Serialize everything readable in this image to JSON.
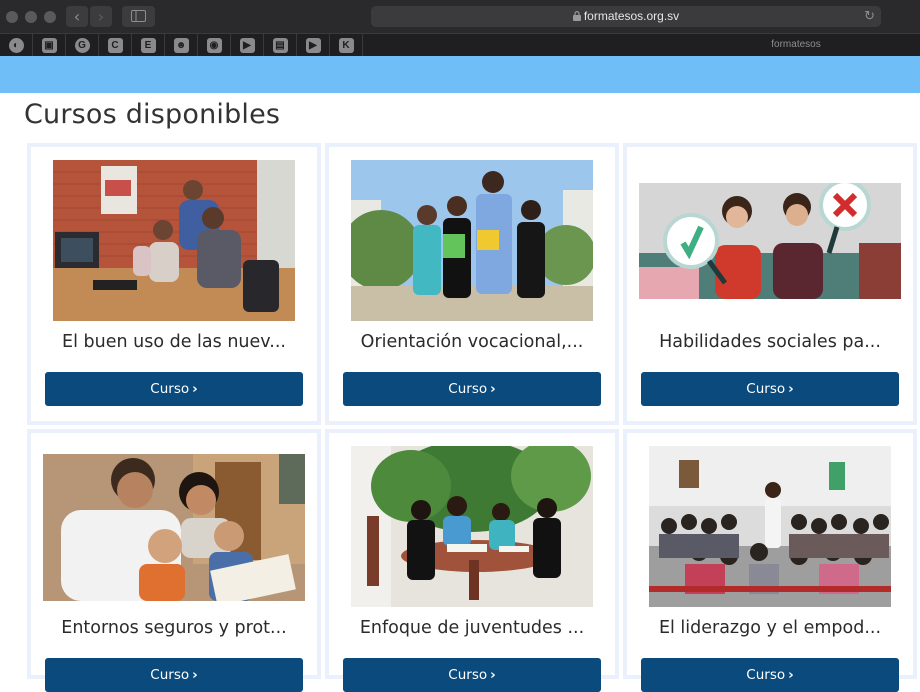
{
  "browser": {
    "url": "formatesos.org.sv",
    "tab_title": "formatesos",
    "back_glyph": "‹",
    "forward_glyph": "›",
    "reload_glyph": "↻",
    "lock_glyph": "🔒"
  },
  "bookmarks": [
    {
      "icon": "globe-icon",
      "glyph": "◐"
    },
    {
      "icon": "news-icon",
      "glyph": "▣"
    },
    {
      "icon": "g-icon",
      "glyph": "G"
    },
    {
      "icon": "c-icon",
      "glyph": "C"
    },
    {
      "icon": "e-icon",
      "glyph": "E"
    },
    {
      "icon": "face-icon",
      "glyph": "☻"
    },
    {
      "icon": "camera-icon",
      "glyph": "◉"
    },
    {
      "icon": "video-icon",
      "glyph": "▶"
    },
    {
      "icon": "photo-icon",
      "glyph": "▤"
    },
    {
      "icon": "play-icon",
      "glyph": "▶"
    },
    {
      "icon": "k-icon",
      "glyph": "K"
    }
  ],
  "page": {
    "title": "Cursos disponibles",
    "header_color": "#6fbef8",
    "button_color": "#0b4a7d"
  },
  "courses": [
    {
      "name": "El buen uso de las nuev...",
      "button_label": "Curso",
      "image": "photo-computer-lab"
    },
    {
      "name": "Orientación vocacional,...",
      "button_label": "Curso",
      "image": "photo-students"
    },
    {
      "name": "Habilidades sociales pa...",
      "button_label": "Curso",
      "image": "photo-signs"
    },
    {
      "name": "Entornos seguros y prot...",
      "button_label": "Curso",
      "image": "photo-family"
    },
    {
      "name": "Enfoque de juventudes ...",
      "button_label": "Curso",
      "image": "photo-meeting"
    },
    {
      "name": "El liderazgo y el empod...",
      "button_label": "Curso",
      "image": "photo-workshop"
    }
  ]
}
